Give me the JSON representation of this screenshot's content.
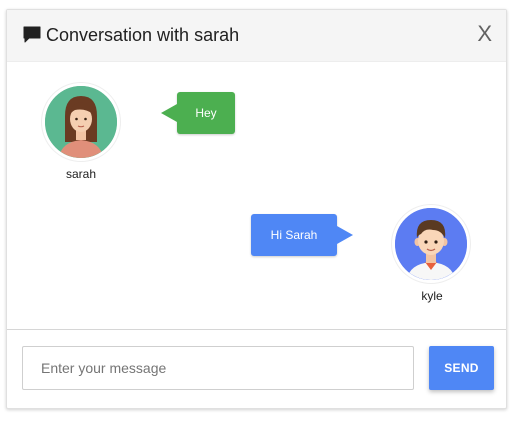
{
  "header": {
    "title": "Conversation with sarah",
    "close_label": "X",
    "icon": "chat-bubble-icon"
  },
  "messages": [
    {
      "sender": "sarah",
      "text": "Hey",
      "side": "left",
      "bubble_color": "#4caf50"
    },
    {
      "sender": "kyle",
      "text": "Hi Sarah",
      "side": "right",
      "bubble_color": "#4f87f5"
    }
  ],
  "composer": {
    "placeholder": "Enter your message",
    "value": "",
    "send_label": "SEND"
  },
  "colors": {
    "accent": "#4f87f5",
    "sarah_bubble": "#4caf50",
    "sarah_avatar_bg": "#5bb891",
    "kyle_avatar_bg": "#5c7cf2"
  }
}
